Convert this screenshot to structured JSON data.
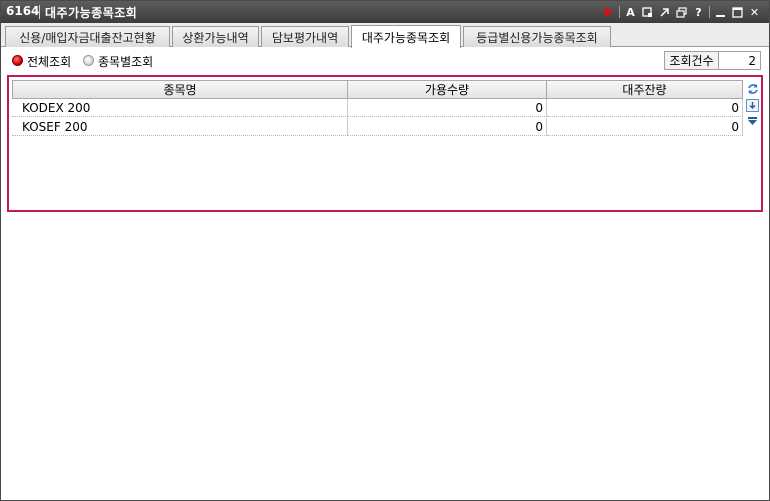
{
  "window": {
    "code": "6164",
    "title": "대주가능종목조회",
    "toolbar_icons": [
      "play-icon",
      "font-icon",
      "copy-icon",
      "popout-icon",
      "cascade-icon",
      "help-icon",
      "minimize-icon",
      "maximize-icon",
      "close-icon"
    ],
    "toolbar_glyphs": {
      "font": "A",
      "help": "?",
      "close": "✕"
    }
  },
  "tabs": [
    {
      "label": "신용/매입자금대출잔고현황",
      "active": false
    },
    {
      "label": "상환가능내역",
      "active": false
    },
    {
      "label": "담보평가내역",
      "active": false
    },
    {
      "label": "대주가능종목조회",
      "active": true
    },
    {
      "label": "등급별신용가능종목조회",
      "active": false
    }
  ],
  "options": {
    "all_label": "전체조회",
    "by_item_label": "종목별조회",
    "selected": "all",
    "count_label": "조회건수",
    "count_value": "2"
  },
  "grid": {
    "columns": [
      "종목명",
      "가용수량",
      "대주잔량"
    ],
    "rows": [
      {
        "name": "KODEX 200",
        "available": "0",
        "balance": "0"
      },
      {
        "name": "KOSEF 200",
        "available": "0",
        "balance": "0"
      }
    ]
  },
  "colors": {
    "titlebar": "#4a4a4a",
    "grid_border": "#c2185b",
    "radio_selected": "#d40000"
  }
}
